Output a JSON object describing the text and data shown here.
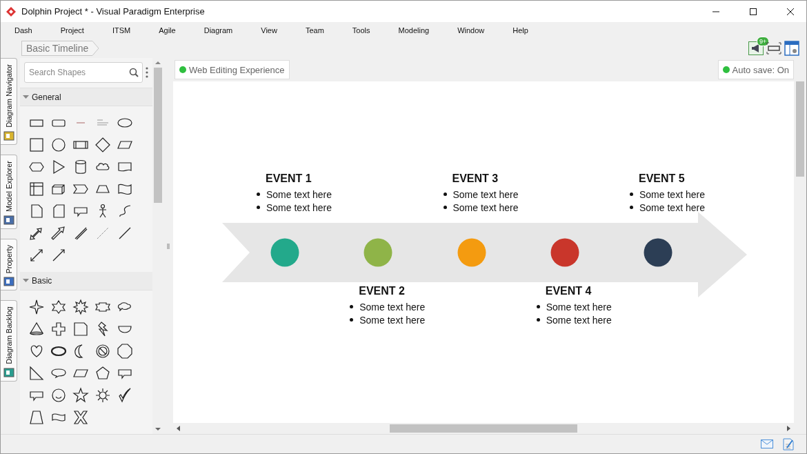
{
  "window": {
    "title": "Dolphin Project * - Visual Paradigm Enterprise"
  },
  "menu": [
    "Dash",
    "Project",
    "ITSM",
    "Agile",
    "Diagram",
    "View",
    "Team",
    "Tools",
    "Modeling",
    "Window",
    "Help"
  ],
  "breadcrumb": "Basic Timeline",
  "notifications": {
    "badge": "9+"
  },
  "side_tabs": [
    "Diagram Navigator",
    "Model Explorer",
    "Property",
    "Diagram Backlog"
  ],
  "palette": {
    "search": {
      "placeholder": "Search Shapes"
    },
    "groups": [
      {
        "label": "General",
        "expanded": true
      },
      {
        "label": "Basic",
        "expanded": true
      }
    ]
  },
  "canvas": {
    "web_editing": "Web Editing Experience",
    "auto_save": "Auto save: On",
    "events": [
      {
        "title": "EVENT 1",
        "color": "#23a98b",
        "items": [
          "Some text here",
          "Some text here"
        ]
      },
      {
        "title": "EVENT 2",
        "color": "#8fb448",
        "items": [
          "Some text here",
          "Some text here"
        ]
      },
      {
        "title": "EVENT 3",
        "color": "#f49b10",
        "items": [
          "Some text here",
          "Some text here"
        ]
      },
      {
        "title": "EVENT 4",
        "color": "#c9362b",
        "items": [
          "Some text here",
          "Some text here"
        ]
      },
      {
        "title": "EVENT 5",
        "color": "#2c3e55",
        "items": [
          "Some text here",
          "Some text here"
        ]
      }
    ]
  }
}
